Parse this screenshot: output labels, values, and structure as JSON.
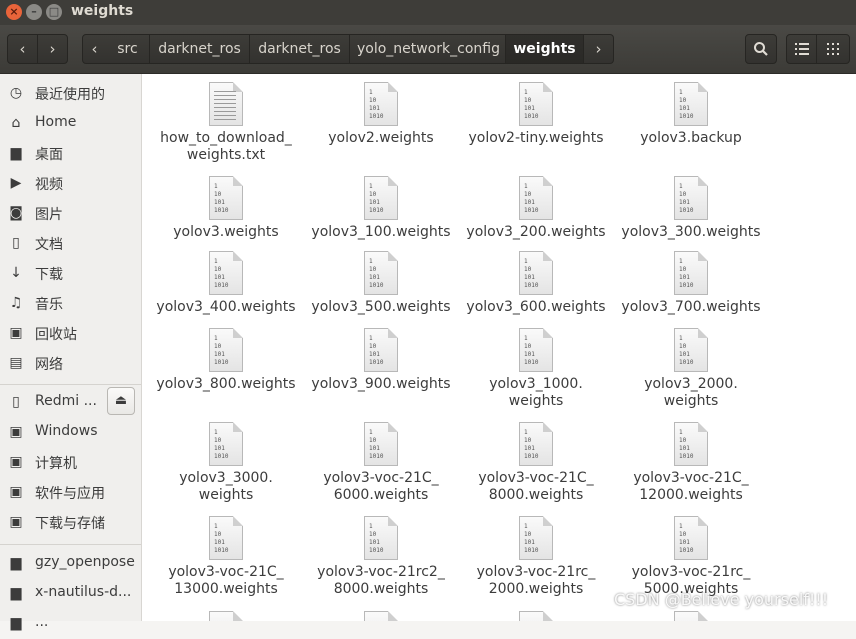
{
  "window": {
    "title": "weights"
  },
  "toolbar": {
    "back_icon": "chevron-left",
    "forward_icon": "chevron-right",
    "breadcrumbs": [
      "src",
      "darknet_ros",
      "darknet_ros",
      "yolo_network_config",
      "weights"
    ],
    "search_icon": "search",
    "list_view_icon": "list",
    "grid_view_icon": "grid"
  },
  "sidebar": {
    "places": [
      {
        "label": "最近使用的",
        "icon": "clock"
      },
      {
        "label": "Home",
        "icon": "home"
      },
      {
        "label": "桌面",
        "icon": "folder"
      },
      {
        "label": "视频",
        "icon": "video"
      },
      {
        "label": "图片",
        "icon": "camera"
      },
      {
        "label": "文档",
        "icon": "document"
      },
      {
        "label": "下载",
        "icon": "download"
      },
      {
        "label": "音乐",
        "icon": "music"
      },
      {
        "label": "回收站",
        "icon": "trash"
      },
      {
        "label": "网络",
        "icon": "network"
      }
    ],
    "devices": [
      {
        "label": "Redmi ...",
        "icon": "phone"
      },
      {
        "label": "Windows",
        "icon": "drive"
      },
      {
        "label": "计算机",
        "icon": "drive"
      },
      {
        "label": "软件与应用",
        "icon": "drive"
      },
      {
        "label": "下载与存储",
        "icon": "drive"
      }
    ],
    "bookmarks": [
      {
        "label": "gzy_openpose",
        "icon": "folder"
      },
      {
        "label": "x-nautilus-d...",
        "icon": "folder"
      },
      {
        "label": "...",
        "icon": "folder"
      }
    ]
  },
  "files": [
    {
      "name": "how_to_download_\nweights.txt",
      "type": "text"
    },
    {
      "name": "yolov2.weights",
      "type": "binary"
    },
    {
      "name": "yolov2-tiny.weights",
      "type": "binary"
    },
    {
      "name": "yolov3.backup",
      "type": "binary"
    },
    {
      "name": "yolov3.weights",
      "type": "binary"
    },
    {
      "name": "yolov3_100.weights",
      "type": "binary"
    },
    {
      "name": "yolov3_200.weights",
      "type": "binary"
    },
    {
      "name": "yolov3_300.weights",
      "type": "binary"
    },
    {
      "name": "yolov3_400.weights",
      "type": "binary"
    },
    {
      "name": "yolov3_500.weights",
      "type": "binary"
    },
    {
      "name": "yolov3_600.weights",
      "type": "binary"
    },
    {
      "name": "yolov3_700.weights",
      "type": "binary"
    },
    {
      "name": "yolov3_800.weights",
      "type": "binary"
    },
    {
      "name": "yolov3_900.weights",
      "type": "binary"
    },
    {
      "name": "yolov3_1000.\nweights",
      "type": "binary"
    },
    {
      "name": "yolov3_2000.\nweights",
      "type": "binary"
    },
    {
      "name": "yolov3_3000.\nweights",
      "type": "binary"
    },
    {
      "name": "yolov3-voc-21C_\n6000.weights",
      "type": "binary"
    },
    {
      "name": "yolov3-voc-21C_\n8000.weights",
      "type": "binary"
    },
    {
      "name": "yolov3-voc-21C_\n12000.weights",
      "type": "binary"
    },
    {
      "name": "yolov3-voc-21C_\n13000.weights",
      "type": "binary"
    },
    {
      "name": "yolov3-voc-21rc2_\n8000.weights",
      "type": "binary"
    },
    {
      "name": "yolov3-voc-21rc_\n2000.weights",
      "type": "binary"
    },
    {
      "name": "yolov3-voc-21rc_\n5000.weights",
      "type": "binary"
    }
  ],
  "binary_icon_text": "1\n10\n101\n1010",
  "watermark": "CSDN @Believe yourself!!!"
}
